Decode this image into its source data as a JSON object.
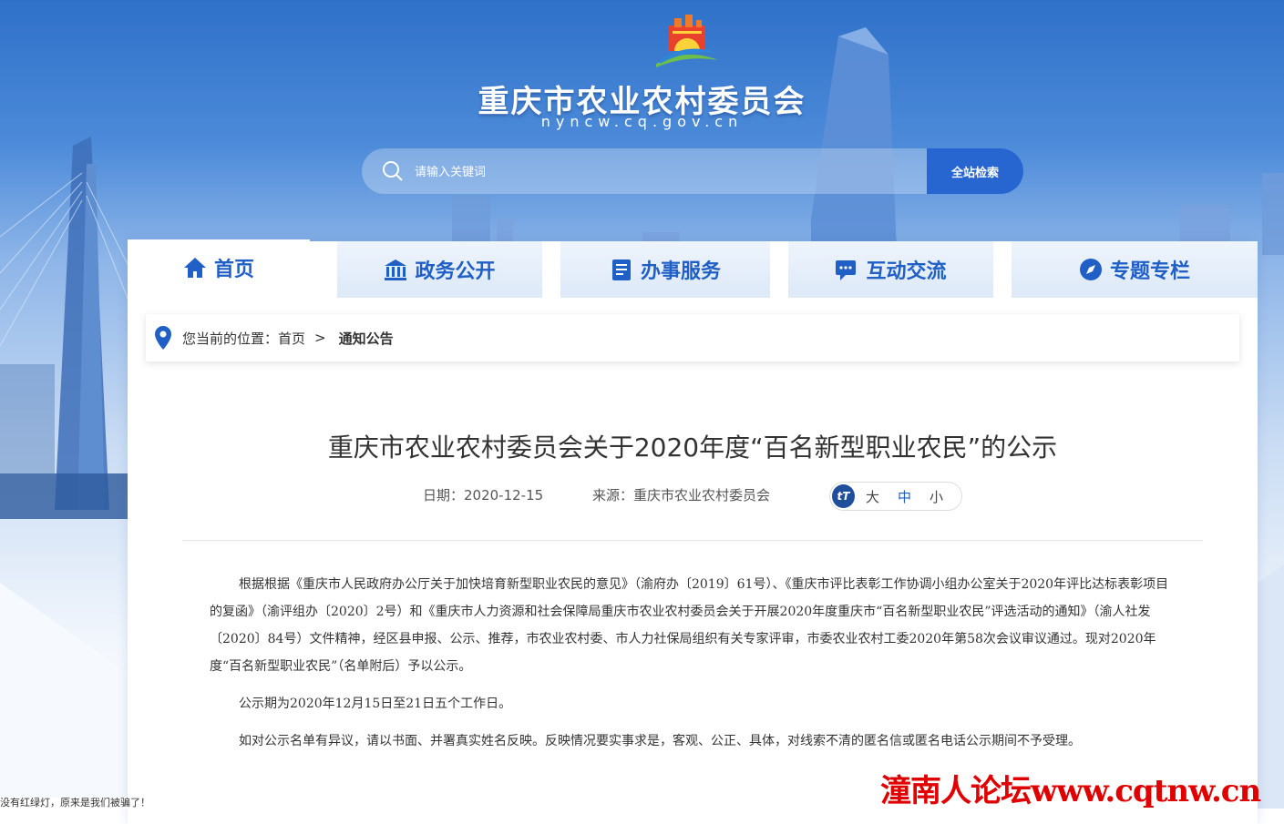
{
  "header": {
    "site_title": "重庆市农业农村委员会",
    "site_domain": "nyncw.cq.gov.cn",
    "search_placeholder": "请输入关键词",
    "search_button": "全站检索"
  },
  "nav": {
    "items": [
      {
        "label": "首页",
        "icon": "home-icon"
      },
      {
        "label": "政务公开",
        "icon": "building-icon"
      },
      {
        "label": "办事服务",
        "icon": "checklist-icon"
      },
      {
        "label": "互动交流",
        "icon": "chat-icon"
      },
      {
        "label": "专题专栏",
        "icon": "compass-icon"
      }
    ]
  },
  "breadcrumb": {
    "prefix": "您当前的位置：",
    "home": "首页",
    "separator": ">",
    "current": "通知公告"
  },
  "article": {
    "title": "重庆市农业农村委员会关于2020年度“百名新型职业农民”的公示",
    "date": "日期：2020-12-15",
    "source": "来源：重庆市农业农村委员会",
    "font_sizes": [
      "大",
      "中",
      "小"
    ],
    "selected_font_size": "中",
    "paragraphs": [
      "根据根据《重庆市人民政府办公厅关于加快培育新型职业农民的意见》（渝府办〔2019〕61号）、《重庆市评比表彰工作协调小组办公室关于2020年评比达标表彰项目的复函》（渝评组办〔2020〕2号）和《重庆市人力资源和社会保障局重庆市农业农村委员会关于开展2020年度重庆市“百名新型职业农民”评选活动的通知》（渝人社发〔2020〕84号）文件精神，经区县申报、公示、推荐，市农业农村委、市人力社保局组织有关专家评审，市委农业农村工委2020年第58次会议审议通过。现对2020年度“百名新型职业农民”（名单附后）予以公示。",
      "公示期为2020年12月15日至21日五个工作日。",
      "如对公示名单有异议，请以书面、并署真实姓名反映。反映情况要实事求是，客观、公正、具体，对线索不清的匿名信或匿名电话公示期间不予受理。"
    ]
  },
  "overlay": {
    "ticker_text": "没有红绿灯，原来是我们被骗了！",
    "watermark": "潼南人论坛www.cqtnw.cn"
  },
  "colors": {
    "primary": "#1f5fc6",
    "search_button": "#2766d0",
    "watermark": "#e00000"
  }
}
